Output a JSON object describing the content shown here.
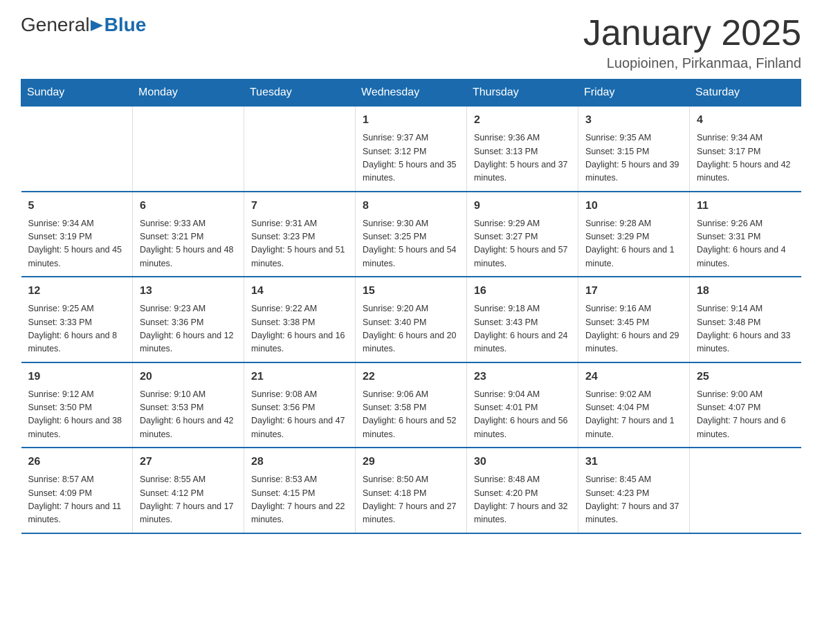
{
  "header": {
    "logo": {
      "general": "General",
      "blue": "Blue",
      "tagline": "Blue"
    },
    "title": "January 2025",
    "location": "Luopioinen, Pirkanmaa, Finland"
  },
  "calendar": {
    "days_of_week": [
      "Sunday",
      "Monday",
      "Tuesday",
      "Wednesday",
      "Thursday",
      "Friday",
      "Saturday"
    ],
    "weeks": [
      [
        {
          "day": "",
          "info": ""
        },
        {
          "day": "",
          "info": ""
        },
        {
          "day": "",
          "info": ""
        },
        {
          "day": "1",
          "info": "Sunrise: 9:37 AM\nSunset: 3:12 PM\nDaylight: 5 hours and 35 minutes."
        },
        {
          "day": "2",
          "info": "Sunrise: 9:36 AM\nSunset: 3:13 PM\nDaylight: 5 hours and 37 minutes."
        },
        {
          "day": "3",
          "info": "Sunrise: 9:35 AM\nSunset: 3:15 PM\nDaylight: 5 hours and 39 minutes."
        },
        {
          "day": "4",
          "info": "Sunrise: 9:34 AM\nSunset: 3:17 PM\nDaylight: 5 hours and 42 minutes."
        }
      ],
      [
        {
          "day": "5",
          "info": "Sunrise: 9:34 AM\nSunset: 3:19 PM\nDaylight: 5 hours and 45 minutes."
        },
        {
          "day": "6",
          "info": "Sunrise: 9:33 AM\nSunset: 3:21 PM\nDaylight: 5 hours and 48 minutes."
        },
        {
          "day": "7",
          "info": "Sunrise: 9:31 AM\nSunset: 3:23 PM\nDaylight: 5 hours and 51 minutes."
        },
        {
          "day": "8",
          "info": "Sunrise: 9:30 AM\nSunset: 3:25 PM\nDaylight: 5 hours and 54 minutes."
        },
        {
          "day": "9",
          "info": "Sunrise: 9:29 AM\nSunset: 3:27 PM\nDaylight: 5 hours and 57 minutes."
        },
        {
          "day": "10",
          "info": "Sunrise: 9:28 AM\nSunset: 3:29 PM\nDaylight: 6 hours and 1 minute."
        },
        {
          "day": "11",
          "info": "Sunrise: 9:26 AM\nSunset: 3:31 PM\nDaylight: 6 hours and 4 minutes."
        }
      ],
      [
        {
          "day": "12",
          "info": "Sunrise: 9:25 AM\nSunset: 3:33 PM\nDaylight: 6 hours and 8 minutes."
        },
        {
          "day": "13",
          "info": "Sunrise: 9:23 AM\nSunset: 3:36 PM\nDaylight: 6 hours and 12 minutes."
        },
        {
          "day": "14",
          "info": "Sunrise: 9:22 AM\nSunset: 3:38 PM\nDaylight: 6 hours and 16 minutes."
        },
        {
          "day": "15",
          "info": "Sunrise: 9:20 AM\nSunset: 3:40 PM\nDaylight: 6 hours and 20 minutes."
        },
        {
          "day": "16",
          "info": "Sunrise: 9:18 AM\nSunset: 3:43 PM\nDaylight: 6 hours and 24 minutes."
        },
        {
          "day": "17",
          "info": "Sunrise: 9:16 AM\nSunset: 3:45 PM\nDaylight: 6 hours and 29 minutes."
        },
        {
          "day": "18",
          "info": "Sunrise: 9:14 AM\nSunset: 3:48 PM\nDaylight: 6 hours and 33 minutes."
        }
      ],
      [
        {
          "day": "19",
          "info": "Sunrise: 9:12 AM\nSunset: 3:50 PM\nDaylight: 6 hours and 38 minutes."
        },
        {
          "day": "20",
          "info": "Sunrise: 9:10 AM\nSunset: 3:53 PM\nDaylight: 6 hours and 42 minutes."
        },
        {
          "day": "21",
          "info": "Sunrise: 9:08 AM\nSunset: 3:56 PM\nDaylight: 6 hours and 47 minutes."
        },
        {
          "day": "22",
          "info": "Sunrise: 9:06 AM\nSunset: 3:58 PM\nDaylight: 6 hours and 52 minutes."
        },
        {
          "day": "23",
          "info": "Sunrise: 9:04 AM\nSunset: 4:01 PM\nDaylight: 6 hours and 56 minutes."
        },
        {
          "day": "24",
          "info": "Sunrise: 9:02 AM\nSunset: 4:04 PM\nDaylight: 7 hours and 1 minute."
        },
        {
          "day": "25",
          "info": "Sunrise: 9:00 AM\nSunset: 4:07 PM\nDaylight: 7 hours and 6 minutes."
        }
      ],
      [
        {
          "day": "26",
          "info": "Sunrise: 8:57 AM\nSunset: 4:09 PM\nDaylight: 7 hours and 11 minutes."
        },
        {
          "day": "27",
          "info": "Sunrise: 8:55 AM\nSunset: 4:12 PM\nDaylight: 7 hours and 17 minutes."
        },
        {
          "day": "28",
          "info": "Sunrise: 8:53 AM\nSunset: 4:15 PM\nDaylight: 7 hours and 22 minutes."
        },
        {
          "day": "29",
          "info": "Sunrise: 8:50 AM\nSunset: 4:18 PM\nDaylight: 7 hours and 27 minutes."
        },
        {
          "day": "30",
          "info": "Sunrise: 8:48 AM\nSunset: 4:20 PM\nDaylight: 7 hours and 32 minutes."
        },
        {
          "day": "31",
          "info": "Sunrise: 8:45 AM\nSunset: 4:23 PM\nDaylight: 7 hours and 37 minutes."
        },
        {
          "day": "",
          "info": ""
        }
      ]
    ]
  }
}
